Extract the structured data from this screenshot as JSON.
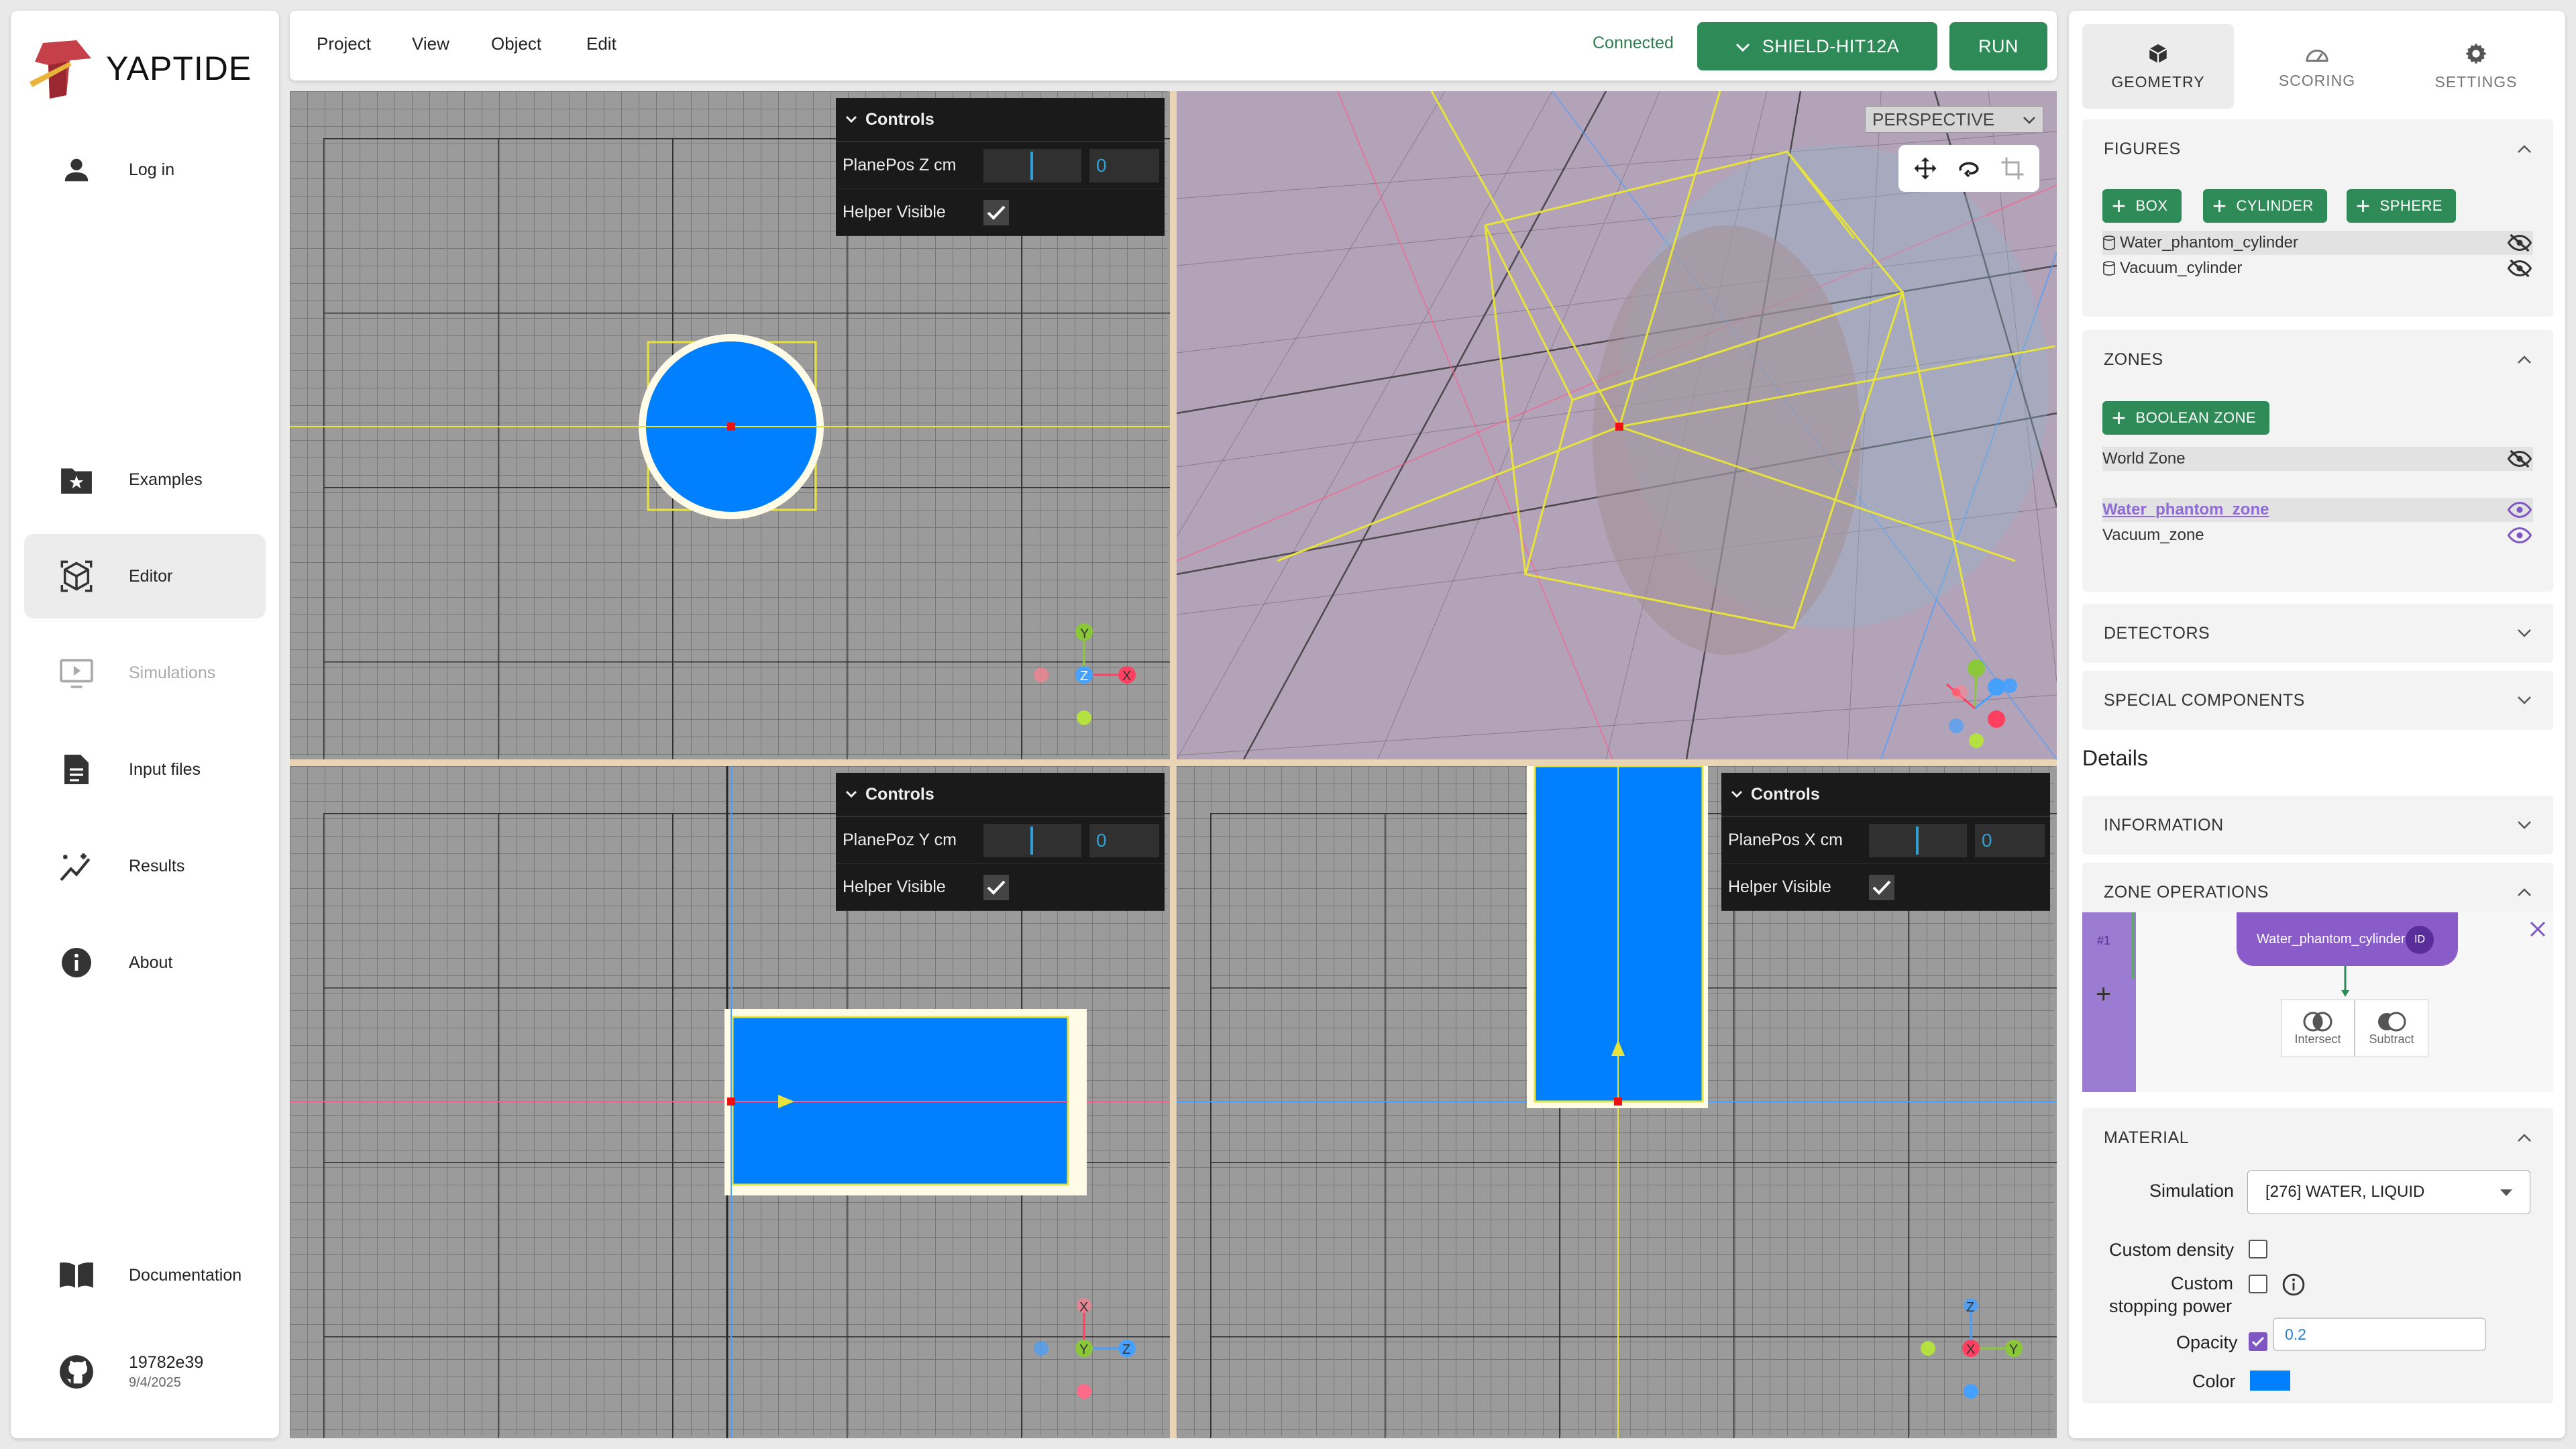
{
  "app": {
    "name": "YAPTIDE"
  },
  "nav": {
    "login": "Log in",
    "examples": "Examples",
    "editor": "Editor",
    "simulations": "Simulations",
    "input_files": "Input files",
    "results": "Results",
    "about": "About",
    "documentation": "Documentation",
    "version": "19782e39",
    "date": "9/4/2025"
  },
  "topbar": {
    "menu": [
      "Project",
      "View",
      "Object",
      "Edit"
    ],
    "status": "Connected",
    "simulator": "SHIELD-HIT12A",
    "run": "RUN"
  },
  "viewport": {
    "controls_title": "Controls",
    "top_left": {
      "plane_label": "PlanePos Z cm",
      "plane_value": "0",
      "helper_label": "Helper Visible"
    },
    "bottom_left": {
      "plane_label": "PlanePoz Y cm",
      "plane_value": "0",
      "helper_label": "Helper Visible"
    },
    "bottom_right": {
      "plane_label": "PlanePos X cm",
      "plane_value": "0",
      "helper_label": "Helper Visible"
    },
    "camera_mode": "PERSPECTIVE",
    "axis": {
      "x": "X",
      "y": "Y",
      "z": "Z"
    }
  },
  "tabs": {
    "geometry": "GEOMETRY",
    "scoring": "SCORING",
    "settings": "SETTINGS"
  },
  "figures": {
    "title": "FIGURES",
    "add_box": "BOX",
    "add_cylinder": "CYLINDER",
    "add_sphere": "SPHERE",
    "items": [
      "Water_phantom_cylinder",
      "Vacuum_cylinder"
    ]
  },
  "zones": {
    "title": "ZONES",
    "add_boolean": "BOOLEAN ZONE",
    "world": "World Zone",
    "items": [
      "Water_phantom_zone",
      "Vacuum_zone"
    ]
  },
  "detectors": {
    "title": "DETECTORS"
  },
  "special": {
    "title": "SPECIAL COMPONENTS"
  },
  "details": {
    "title": "Details"
  },
  "information": {
    "title": "INFORMATION"
  },
  "zone_operations": {
    "title": "ZONE OPERATIONS",
    "index": "#1",
    "node": "Water_phantom_cylinder",
    "id_badge": "ID",
    "intersect": "Intersect",
    "subtract": "Subtract"
  },
  "material": {
    "title": "MATERIAL",
    "simulation_label": "Simulation",
    "simulation_value": "[276] WATER, LIQUID",
    "custom_density": "Custom density",
    "custom_stopping_1": "Custom",
    "custom_stopping_2": "stopping power",
    "opacity_label": "Opacity",
    "opacity_value": "0.2",
    "color_label": "Color",
    "color_value": "#0080ff"
  },
  "colors": {
    "accent": "#2e8b57",
    "zone": "#8a5cc9",
    "figure": "#0080ff"
  }
}
